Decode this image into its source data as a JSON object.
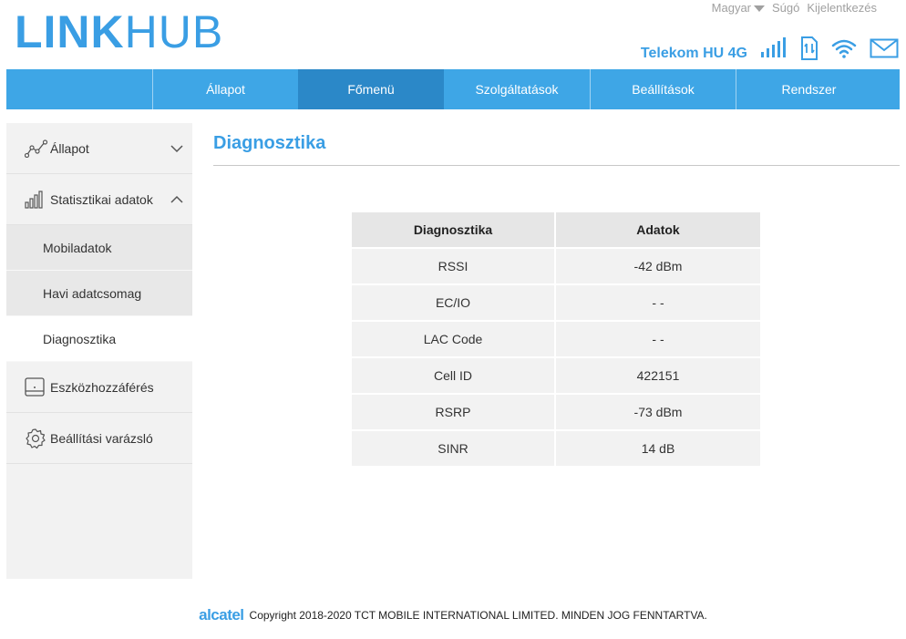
{
  "brand": {
    "logo_part1": "LINK",
    "logo_part2": "HUB"
  },
  "toplinks": {
    "language": "Magyar",
    "help": "Súgó",
    "logout": "Kijelentkezés"
  },
  "status": {
    "operator": "Telekom HU 4G",
    "colors": {
      "accent": "#3a9ee4",
      "nav": "#3ea6e6",
      "nav_active": "#2b88c8"
    }
  },
  "nav": {
    "items": [
      {
        "label": "Állapot"
      },
      {
        "label": "Főmenü",
        "active": true
      },
      {
        "label": "Szolgáltatások"
      },
      {
        "label": "Beállítások"
      },
      {
        "label": "Rendszer"
      }
    ]
  },
  "sidebar": {
    "items": [
      {
        "label": "Állapot",
        "icon": "chart-line-icon"
      },
      {
        "label": "Statisztikai adatok",
        "icon": "bar-stats-icon"
      },
      {
        "label": "Mobiladatok"
      },
      {
        "label": "Havi adatcsomag"
      },
      {
        "label": "Diagnosztika"
      },
      {
        "label": "Eszközhozzáférés",
        "icon": "device-icon"
      },
      {
        "label": "Beállítási varázsló",
        "icon": "gear-icon"
      }
    ]
  },
  "main": {
    "title": "Diagnosztika",
    "table": {
      "headers": [
        "Diagnosztika",
        "Adatok"
      ],
      "rows": [
        [
          "RSSI",
          "-42 dBm"
        ],
        [
          "EC/IO",
          "- -"
        ],
        [
          "LAC Code",
          "- -"
        ],
        [
          "Cell ID",
          "422151"
        ],
        [
          "RSRP",
          "-73 dBm"
        ],
        [
          "SINR",
          "14 dB"
        ]
      ]
    }
  },
  "footer": {
    "brand": "alcatel",
    "copyright": "Copyright 2018-2020 TCT MOBILE INTERNATIONAL LIMITED. MINDEN JOG FENNTARTVA."
  }
}
